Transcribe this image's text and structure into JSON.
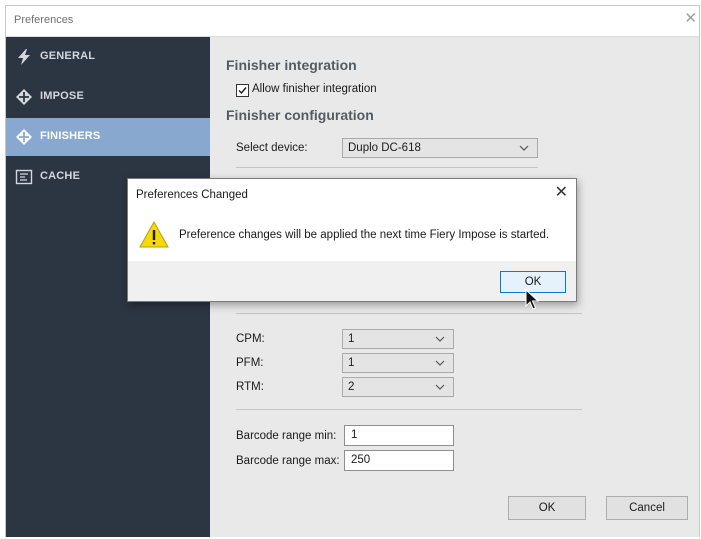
{
  "window": {
    "title": "Preferences",
    "close_glyph": "✕"
  },
  "sidebar": {
    "items": [
      {
        "label": "GENERAL",
        "icon": "lightning-icon",
        "active": false
      },
      {
        "label": "IMPOSE",
        "icon": "diamond-arrows-icon",
        "active": false
      },
      {
        "label": "FINISHERS",
        "icon": "diamond-arrows-icon",
        "active": true
      },
      {
        "label": "CACHE",
        "icon": "cache-icon",
        "active": false
      }
    ]
  },
  "finisher": {
    "integration_heading": "Finisher integration",
    "allow_label": "Allow finisher integration",
    "allow_checked": true,
    "config_heading": "Finisher configuration",
    "device_label": "Select device:",
    "device_value": "Duplo DC-618",
    "cpm_label": "CPM:",
    "cpm_value": "1",
    "pfm_label": "PFM:",
    "pfm_value": "1",
    "rtm_label": "RTM:",
    "rtm_value": "2",
    "barcode_min_label": "Barcode range min:",
    "barcode_min_value": "1",
    "barcode_max_label": "Barcode range max:",
    "barcode_max_value": "250"
  },
  "footer": {
    "ok_label": "OK",
    "cancel_label": "Cancel"
  },
  "dialog": {
    "title": "Preferences Changed",
    "message": "Preference changes will be applied the next time Fiery Impose is started.",
    "ok_label": "OK",
    "close_glyph": "✕"
  },
  "colors": {
    "sidebar_bg": "#2c3542",
    "sidebar_active": "#88a8d0",
    "content_bg": "#e9e9e9",
    "warning_yellow": "#f5d90a",
    "focus_blue": "#0a78d7"
  }
}
